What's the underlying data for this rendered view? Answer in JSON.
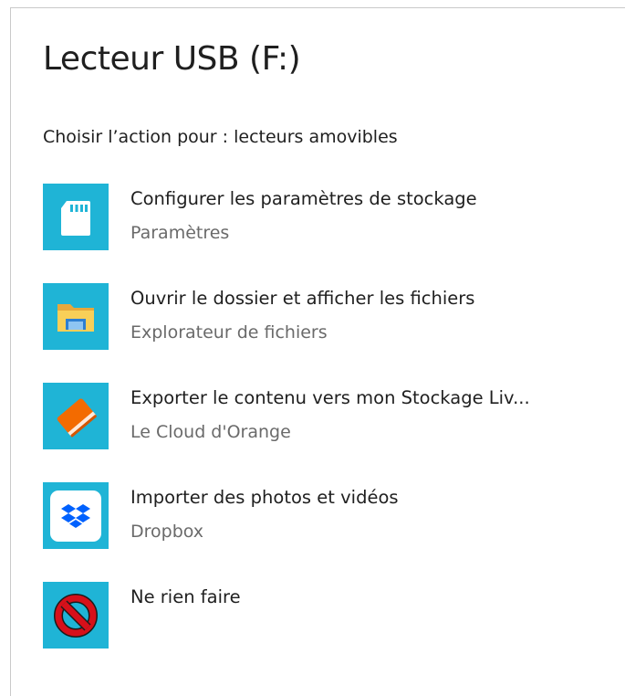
{
  "dialog": {
    "title": "Lecteur USB (F:)",
    "subtitle": "Choisir l’action pour : lecteurs amovibles",
    "tile_color": "#1fb4d6"
  },
  "options": [
    {
      "label": "Configurer les paramètres de stockage",
      "app": "Paramètres",
      "icon": "sd-card-icon"
    },
    {
      "label": "Ouvrir le dossier et afficher les fichiers",
      "app": "Explorateur de fichiers",
      "icon": "file-explorer-icon"
    },
    {
      "label": "Exporter le contenu vers mon Stockage Liv...",
      "app": "Le Cloud d'Orange",
      "icon": "orange-cloud-book-icon"
    },
    {
      "label": "Importer des photos et vidéos",
      "app": "Dropbox",
      "icon": "dropbox-icon"
    },
    {
      "label": "Ne rien faire",
      "app": "",
      "icon": "prohibited-icon"
    }
  ]
}
